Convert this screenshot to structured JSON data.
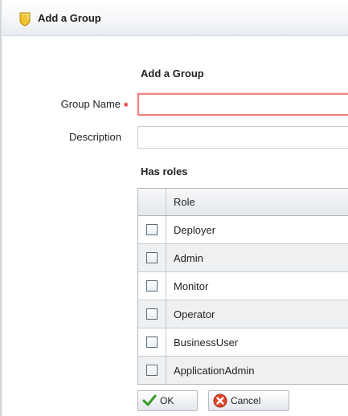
{
  "header": {
    "title": "Add a Group",
    "icon": "group-badge-icon",
    "icon_color": "#e8b820"
  },
  "form": {
    "section_title": "Add a Group",
    "group_name_label": "Group Name",
    "group_name_value": "",
    "required_marker": "*",
    "description_label": "Description",
    "description_value": ""
  },
  "roles": {
    "title": "Has roles",
    "column_header": "Role",
    "items": [
      {
        "label": "Deployer",
        "checked": false
      },
      {
        "label": "Admin",
        "checked": false
      },
      {
        "label": "Monitor",
        "checked": false
      },
      {
        "label": "Operator",
        "checked": false
      },
      {
        "label": "BusinessUser",
        "checked": false
      },
      {
        "label": "ApplicationAdmin",
        "checked": false
      }
    ]
  },
  "buttons": {
    "ok_label": "OK",
    "ok_icon": "checkmark-icon",
    "cancel_label": "Cancel",
    "cancel_icon": "cancel-x-icon"
  },
  "colors": {
    "required": "#dd2222",
    "ok_check": "#3a9a2a",
    "cancel_icon": "#e0442c"
  }
}
